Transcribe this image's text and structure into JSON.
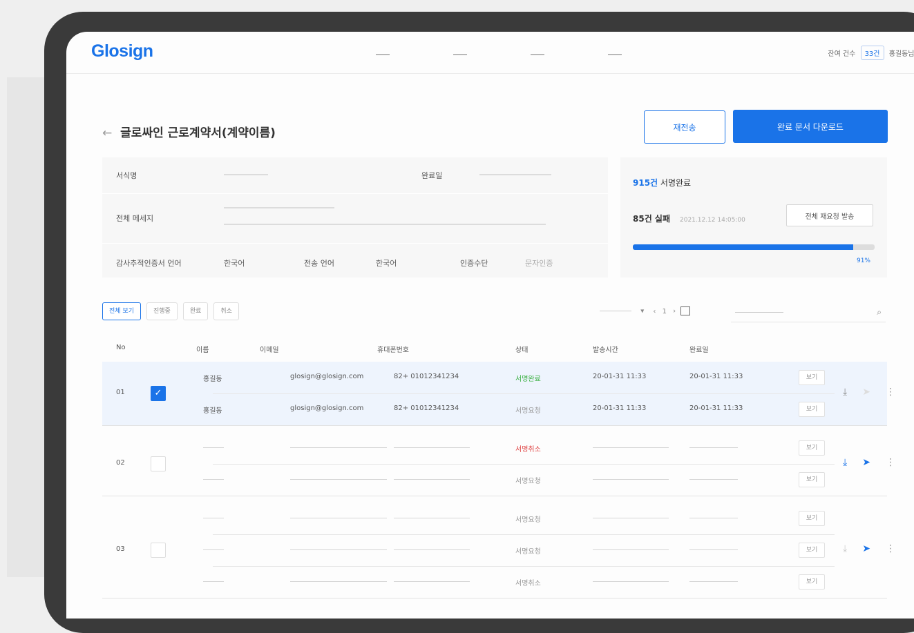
{
  "brand": "Glosign",
  "nav": {
    "right_text": "잔여 건수",
    "credit": "33건",
    "user": "홍길동님 ∨"
  },
  "page": {
    "back": "←",
    "title": "글로싸인 근로계약서(계약이름)",
    "resend_button": "재전송",
    "download_button": "완료 문서 다운로드"
  },
  "info": {
    "doc_name_label": "서식명",
    "complete_label": "완료일",
    "message_label": "전체 메세지",
    "lang_label": "감사추적인증서 언어",
    "lang_value": "한국어",
    "send_lang_label": "전송 언어",
    "send_lang_value": "한국어",
    "auth_label": "인증수단",
    "auth_value": "문자인증"
  },
  "stats": {
    "count": "915건",
    "count_suffix": "서명완료",
    "failed": "85건 실패",
    "failed_note": "2021.12.12 14:05:00",
    "retry_button": "전체 재요청 발송",
    "progress": 0.91,
    "progress_label": "91%"
  },
  "filters": [
    "전체 보기",
    "진행중",
    "완료",
    "취소"
  ],
  "pager": {
    "current": "1",
    "prev": "‹",
    "next": "›"
  },
  "columns": [
    "No",
    "이름",
    "이메일",
    "휴대폰번호",
    "상태",
    "발송시간",
    "완료일"
  ],
  "groups": [
    {
      "no": "01",
      "checked": true,
      "rows": [
        {
          "name": "홍길동",
          "email": "glosign@glosign.com",
          "phone": "82+ 01012341234",
          "status": "서명완료",
          "status_color": "#3cb043",
          "sent": "20-01-31 11:33",
          "done": "20-01-31 11:33",
          "btn": "보기"
        },
        {
          "name": "홍길동",
          "email": "glosign@glosign.com",
          "phone": "82+ 01012341234",
          "status": "서명요청",
          "status_color": "#999999",
          "sent": "20-01-31 11:33",
          "done": "20-01-31 11:33",
          "btn": "보기"
        }
      ]
    },
    {
      "no": "02",
      "checked": false,
      "rows": [
        {
          "status": "서명취소",
          "status_color": "#e04848",
          "btn": "보기"
        },
        {
          "status": "서명요청",
          "status_color": "#999999",
          "btn": "보기"
        }
      ]
    },
    {
      "no": "03",
      "checked": false,
      "rows": [
        {
          "status": "서명요청",
          "status_color": "#999999",
          "btn": "보기"
        },
        {
          "status": "서명요청",
          "status_color": "#999999",
          "btn": "보기"
        },
        {
          "status": "서명취소",
          "status_color": "#999999",
          "btn": "보기"
        }
      ]
    }
  ],
  "accent": "#1a73e8"
}
